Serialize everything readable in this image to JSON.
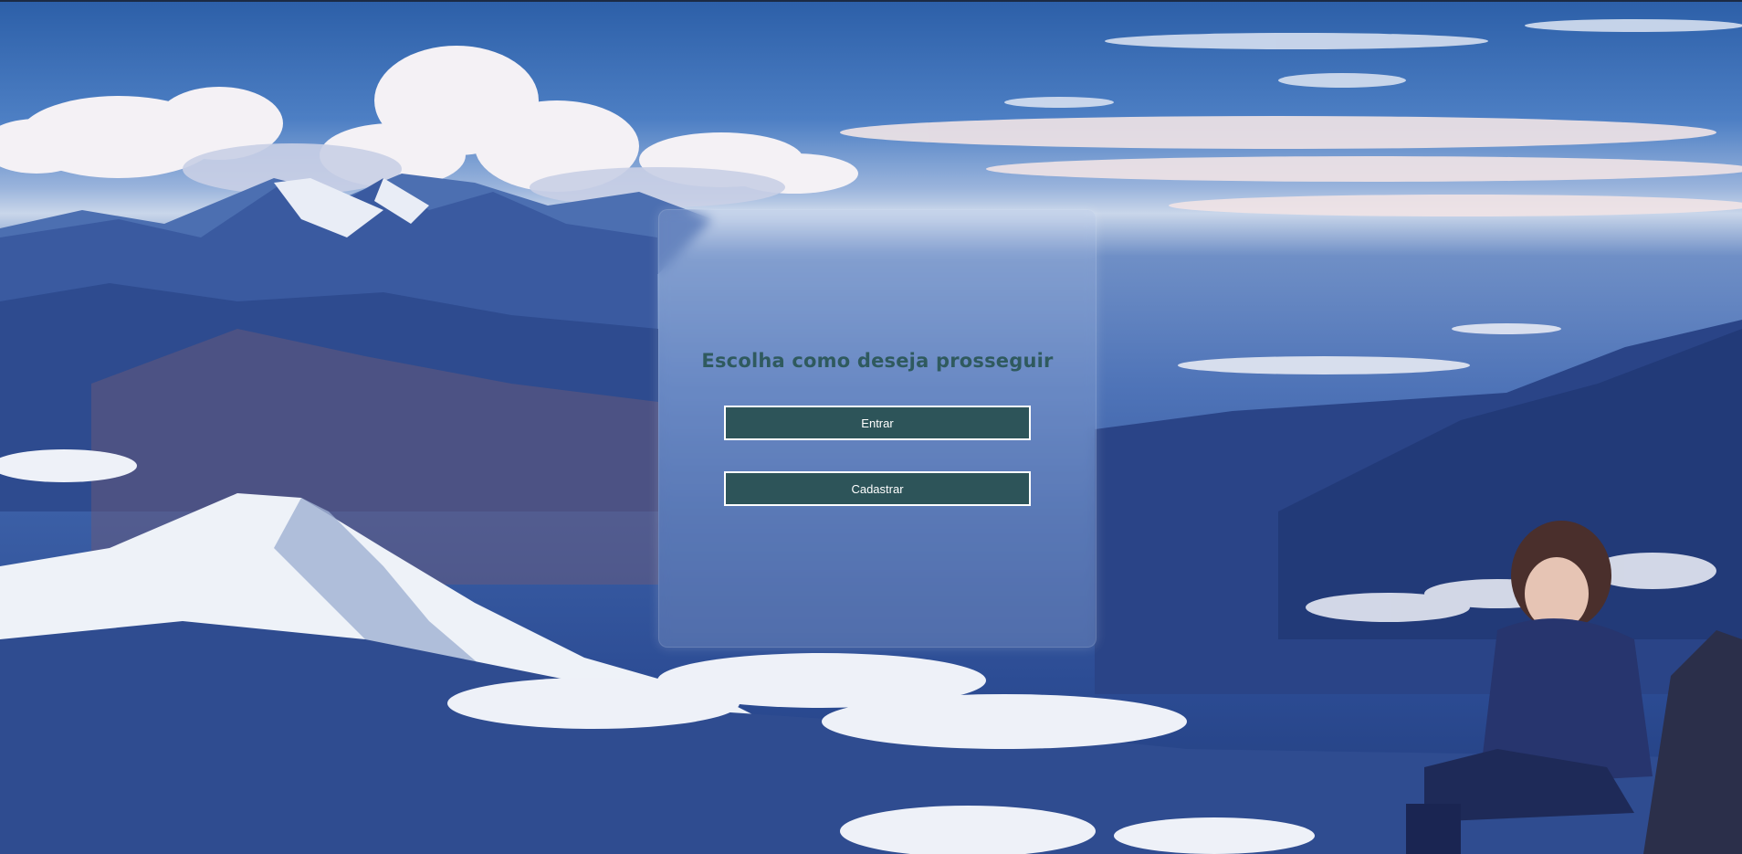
{
  "page": {
    "title": "Escolha como deseja prosseguir"
  },
  "actions": {
    "login_label": "Entrar",
    "register_label": "Cadastrar"
  },
  "colors": {
    "button_bg": "#2d5459",
    "button_border": "#ffffff",
    "title_color": "#2f5a5e",
    "sky": "#2c5fa8"
  }
}
